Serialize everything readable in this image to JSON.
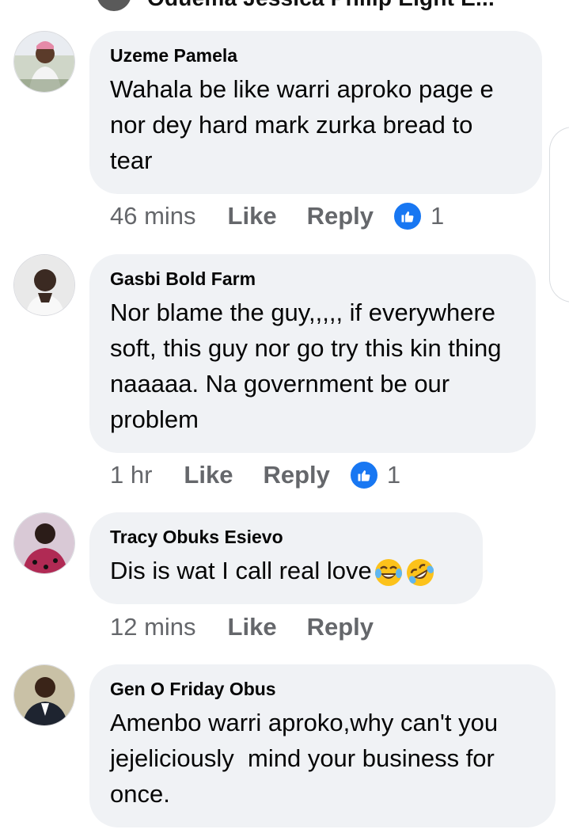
{
  "top_partial": {
    "text": "Oduema Jessica Philip Eight E..."
  },
  "comments": [
    {
      "author": "Uzeme Pamela",
      "text": "Wahala be like warri aproko page e nor dey hard mark zurka bread to tear",
      "time": "46 mins",
      "like": "Like",
      "reply": "Reply",
      "reactions": "1",
      "reaction_icon": "thumbs-up-icon"
    },
    {
      "author": "Gasbi Bold Farm",
      "text": "Nor blame the guy,,,,, if everywhere soft, this guy nor go try this kin thing naaaaa. Na government be our problem",
      "time": "1 hr",
      "like": "Like",
      "reply": "Reply",
      "reactions": "1",
      "reaction_icon": "thumbs-up-icon"
    },
    {
      "author": "Tracy Obuks Esievo",
      "text": "Dis is wat I call real love",
      "emojis": [
        "tears-of-joy-emoji",
        "rolling-laughing-emoji"
      ],
      "time": "12 mins",
      "like": "Like",
      "reply": "Reply"
    },
    {
      "author": "Gen O Friday Obus",
      "text": "Amenbo warri aproko,why can't you jejeliciously  mind your business for once."
    }
  ],
  "colors": {
    "bubble": "#f0f2f5",
    "meta_text": "#65676b",
    "like_blue": "#1877f2"
  }
}
